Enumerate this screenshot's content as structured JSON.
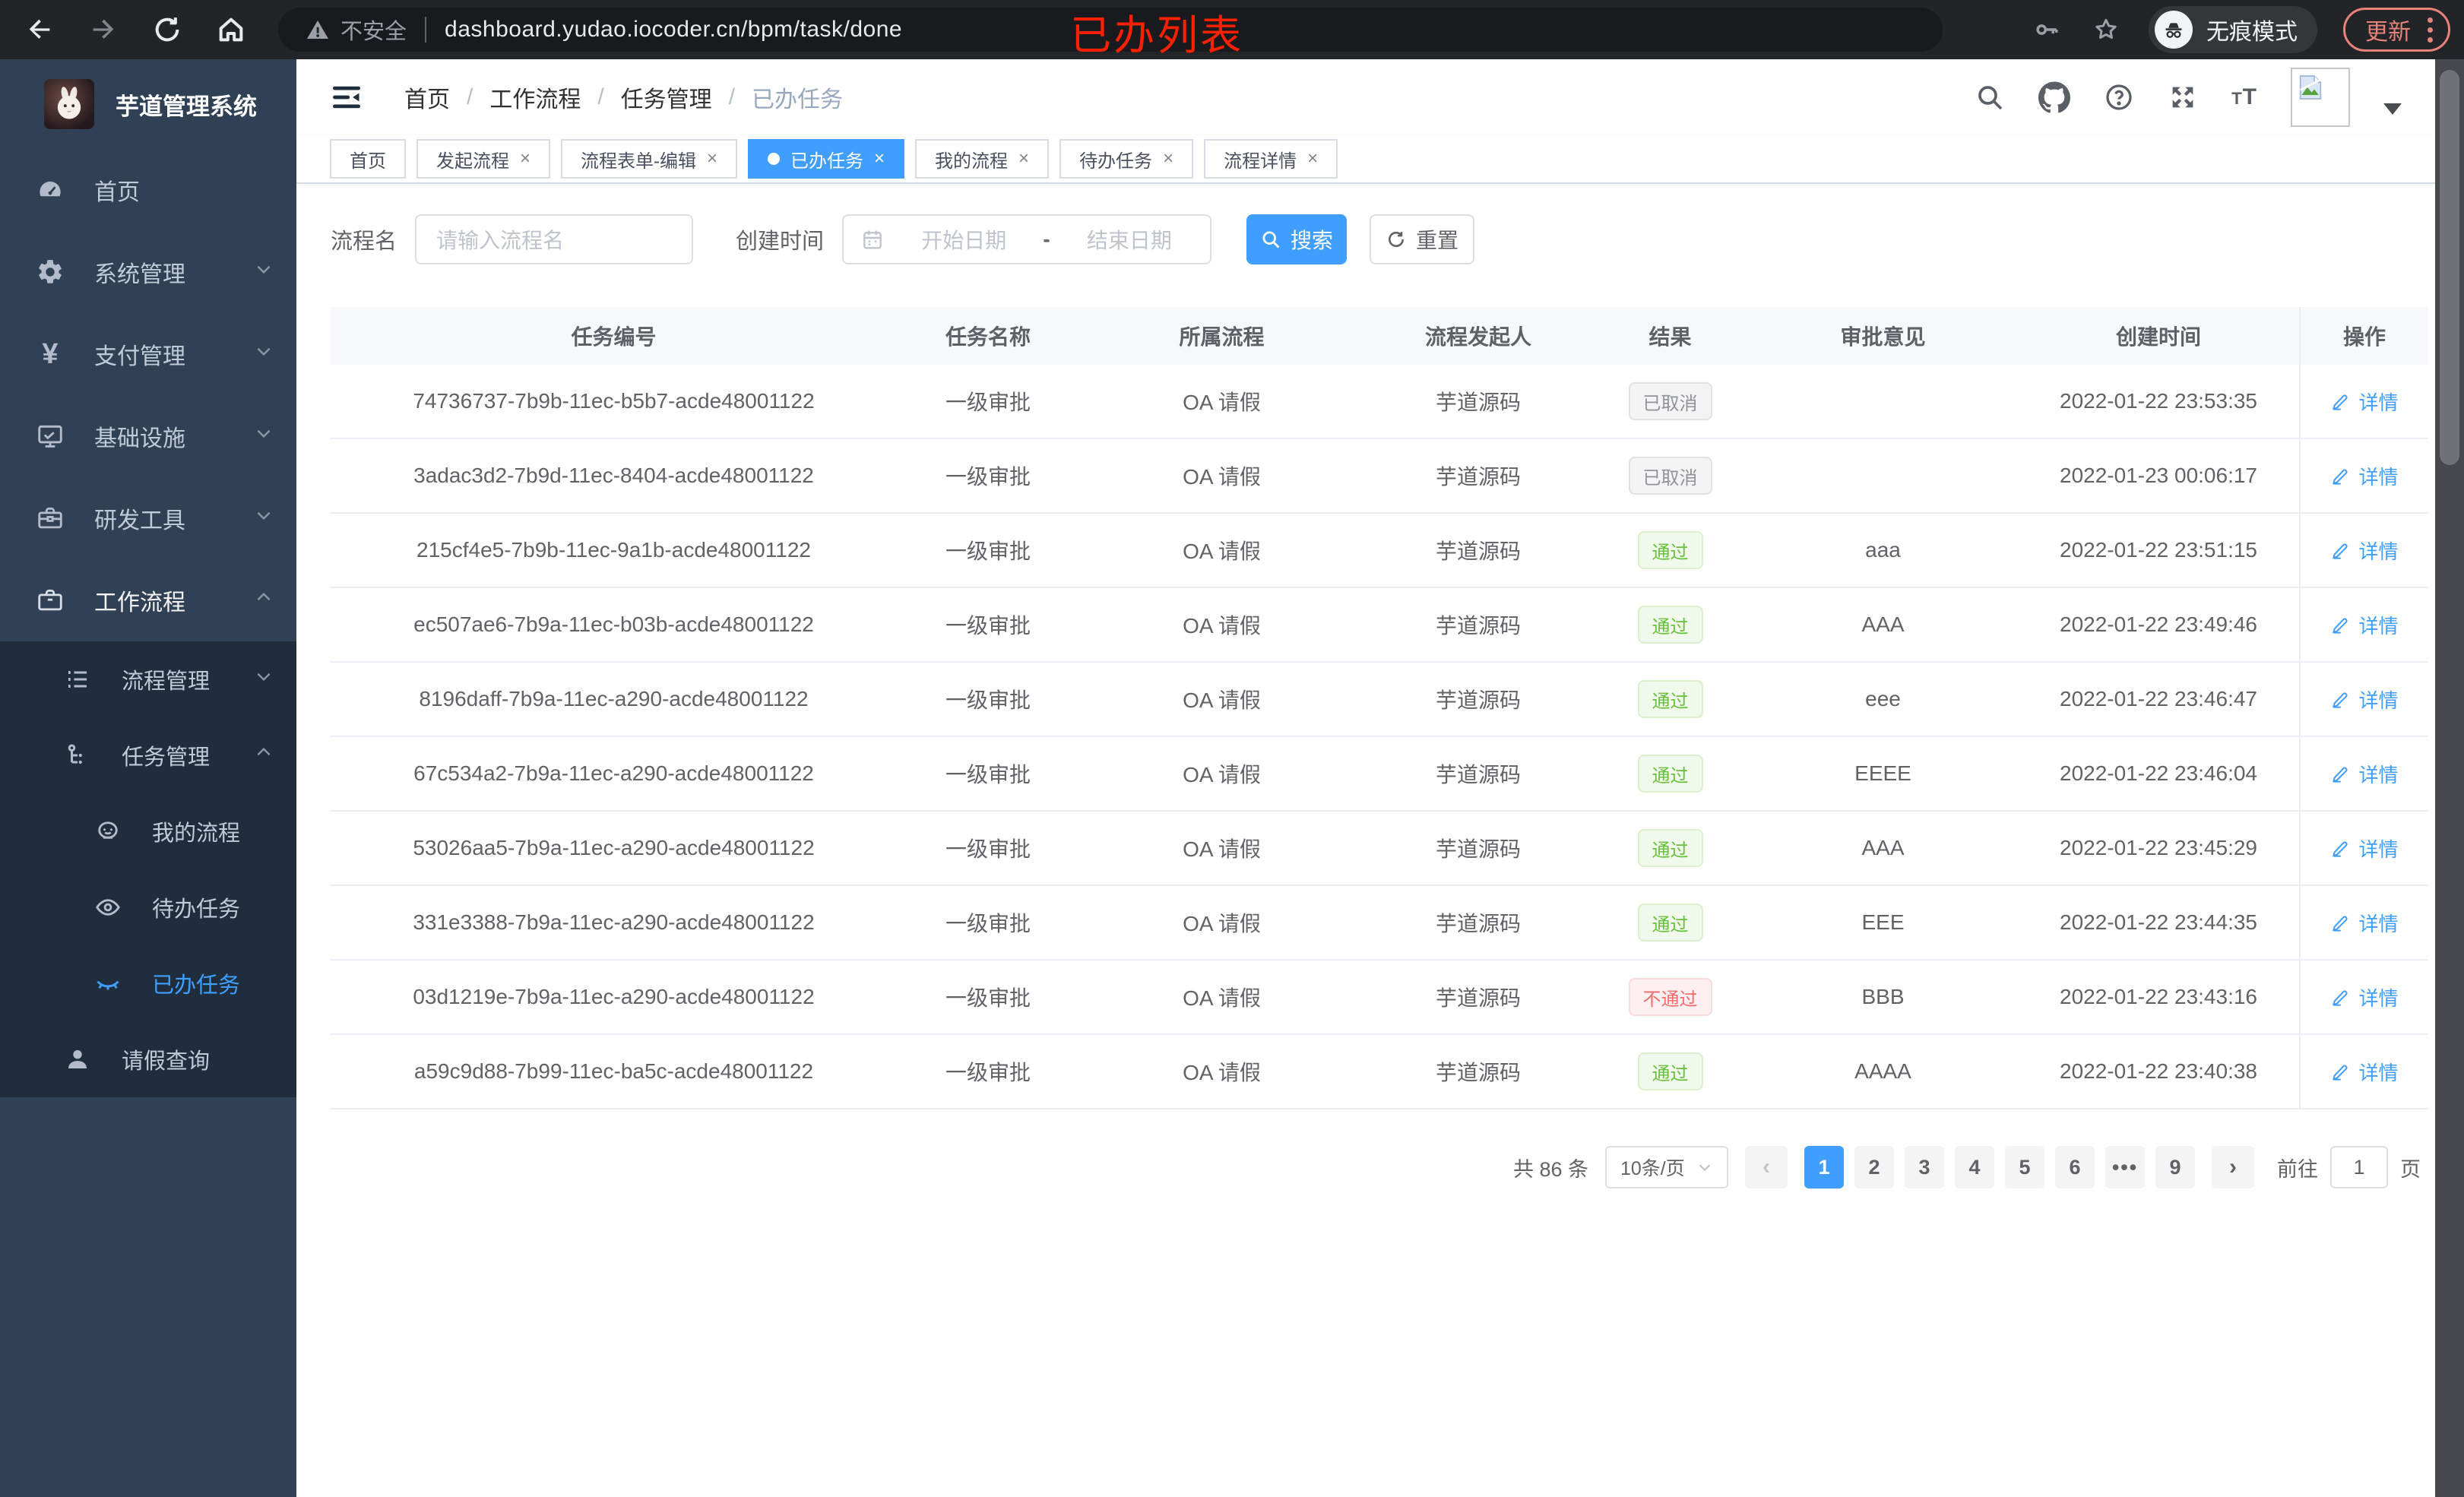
{
  "annotation": {
    "text": "已办列表",
    "color": "#ff2000"
  },
  "browser": {
    "security_label": "不安全",
    "url": "dashboard.yudao.iocoder.cn/bpm/task/done",
    "incognito_label": "无痕模式",
    "update_label": "更新"
  },
  "sidebar": {
    "app_title": "芋道管理系统",
    "items": [
      {
        "label": "首页",
        "icon": "dashboard-icon"
      },
      {
        "label": "系统管理",
        "icon": "gear-icon"
      },
      {
        "label": "支付管理",
        "icon": "yen-icon"
      },
      {
        "label": "基础设施",
        "icon": "monitor-icon"
      },
      {
        "label": "研发工具",
        "icon": "toolbox-icon"
      },
      {
        "label": "工作流程",
        "icon": "briefcase-icon",
        "expanded": true,
        "children": [
          {
            "label": "流程管理",
            "icon": "list-icon"
          },
          {
            "label": "任务管理",
            "icon": "flow-icon",
            "expanded": true,
            "children": [
              {
                "label": "我的流程",
                "icon": "face-icon"
              },
              {
                "label": "待办任务",
                "icon": "eye-icon"
              },
              {
                "label": "已办任务",
                "icon": "eye-closed-icon",
                "active": true
              }
            ]
          },
          {
            "label": "请假查询",
            "icon": "user-icon"
          }
        ]
      }
    ]
  },
  "breadcrumb": [
    "首页",
    "工作流程",
    "任务管理",
    "已办任务"
  ],
  "tabs": [
    {
      "label": "首页",
      "closable": false,
      "active": false
    },
    {
      "label": "发起流程",
      "closable": true,
      "active": false
    },
    {
      "label": "流程表单-编辑",
      "closable": true,
      "active": false
    },
    {
      "label": "已办任务",
      "closable": true,
      "active": true
    },
    {
      "label": "我的流程",
      "closable": true,
      "active": false
    },
    {
      "label": "待办任务",
      "closable": true,
      "active": false
    },
    {
      "label": "流程详情",
      "closable": true,
      "active": false
    }
  ],
  "filters": {
    "process_name_label": "流程名",
    "process_name_placeholder": "请输入流程名",
    "create_time_label": "创建时间",
    "date_start_placeholder": "开始日期",
    "date_separator": "-",
    "date_end_placeholder": "结束日期",
    "search_label": "搜索",
    "reset_label": "重置"
  },
  "table": {
    "columns": [
      "任务编号",
      "任务名称",
      "所属流程",
      "流程发起人",
      "结果",
      "审批意见",
      "创建时间",
      "操作"
    ],
    "action_label": "详情",
    "rows": [
      {
        "id": "74736737-7b9b-11ec-b5b7-acde48001122",
        "name": "一级审批",
        "process": "OA 请假",
        "starter": "芋道源码",
        "result": "已取消",
        "result_type": "info",
        "comment": "",
        "time": "2022-01-22 23:53:35"
      },
      {
        "id": "3adac3d2-7b9d-11ec-8404-acde48001122",
        "name": "一级审批",
        "process": "OA 请假",
        "starter": "芋道源码",
        "result": "已取消",
        "result_type": "info",
        "comment": "",
        "time": "2022-01-23 00:06:17"
      },
      {
        "id": "215cf4e5-7b9b-11ec-9a1b-acde48001122",
        "name": "一级审批",
        "process": "OA 请假",
        "starter": "芋道源码",
        "result": "通过",
        "result_type": "success",
        "comment": "aaa",
        "time": "2022-01-22 23:51:15"
      },
      {
        "id": "ec507ae6-7b9a-11ec-b03b-acde48001122",
        "name": "一级审批",
        "process": "OA 请假",
        "starter": "芋道源码",
        "result": "通过",
        "result_type": "success",
        "comment": "AAA",
        "time": "2022-01-22 23:49:46"
      },
      {
        "id": "8196daff-7b9a-11ec-a290-acde48001122",
        "name": "一级审批",
        "process": "OA 请假",
        "starter": "芋道源码",
        "result": "通过",
        "result_type": "success",
        "comment": "eee",
        "time": "2022-01-22 23:46:47"
      },
      {
        "id": "67c534a2-7b9a-11ec-a290-acde48001122",
        "name": "一级审批",
        "process": "OA 请假",
        "starter": "芋道源码",
        "result": "通过",
        "result_type": "success",
        "comment": "EEEE",
        "time": "2022-01-22 23:46:04"
      },
      {
        "id": "53026aa5-7b9a-11ec-a290-acde48001122",
        "name": "一级审批",
        "process": "OA 请假",
        "starter": "芋道源码",
        "result": "通过",
        "result_type": "success",
        "comment": "AAA",
        "time": "2022-01-22 23:45:29"
      },
      {
        "id": "331e3388-7b9a-11ec-a290-acde48001122",
        "name": "一级审批",
        "process": "OA 请假",
        "starter": "芋道源码",
        "result": "通过",
        "result_type": "success",
        "comment": "EEE",
        "time": "2022-01-22 23:44:35"
      },
      {
        "id": "03d1219e-7b9a-11ec-a290-acde48001122",
        "name": "一级审批",
        "process": "OA 请假",
        "starter": "芋道源码",
        "result": "不通过",
        "result_type": "danger",
        "comment": "BBB",
        "time": "2022-01-22 23:43:16"
      },
      {
        "id": "a59c9d88-7b99-11ec-ba5c-acde48001122",
        "name": "一级审批",
        "process": "OA 请假",
        "starter": "芋道源码",
        "result": "通过",
        "result_type": "success",
        "comment": "AAAA",
        "time": "2022-01-22 23:40:38"
      }
    ]
  },
  "pagination": {
    "total_text": "共 86 条",
    "page_size": "10条/页",
    "prev_symbol": "‹",
    "next_symbol": "›",
    "pages": [
      "1",
      "2",
      "3",
      "4",
      "5",
      "6",
      "...",
      "9"
    ],
    "active_page": "1",
    "goto_label": "前往",
    "goto_value": "1",
    "page_suffix": "页"
  },
  "icons": {
    "legend": [
      "back-icon",
      "forward-icon",
      "reload-icon",
      "home-icon",
      "warning-icon",
      "key-icon",
      "star-icon",
      "incognito-icon",
      "search-icon",
      "github-icon",
      "help-icon",
      "fullscreen-icon",
      "font-size-icon",
      "hamburger-icon",
      "calendar-icon",
      "refresh-icon",
      "pencil-icon"
    ]
  },
  "colors": {
    "accent": "#409eff",
    "success": "#67c23a",
    "danger": "#f56c6c",
    "info": "#909399",
    "sidebar_bg": "#304156",
    "submenu_bg": "#1f2d3d",
    "annotation": "#ff2000"
  }
}
